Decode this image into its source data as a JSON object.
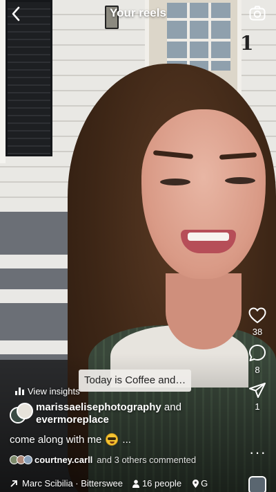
{
  "header": {
    "title": "Your reels"
  },
  "actions": {
    "likes": "38",
    "comments": "8",
    "shares": "1"
  },
  "sticker": {
    "text": "Today is Coffee and…"
  },
  "insights": {
    "label": "View insights"
  },
  "post": {
    "author": "marissaelisephotography",
    "conjunction": "and",
    "collaborator": "evermoreplace",
    "caption": "come along with me",
    "caption_suffix": "..."
  },
  "comments_summary": {
    "user": "courtney.carll",
    "rest": "and 3 others commented"
  },
  "bottom": {
    "audio": "Marc Scibilia · Bitterswee",
    "people": "16 people",
    "location": "G"
  },
  "colors": {
    "text": "#ffffff",
    "sticker_bg": "#f0eeea",
    "sticker_text": "#222222"
  },
  "icons": [
    "back-chevron-icon",
    "camera-icon",
    "heart-icon",
    "comment-icon",
    "send-icon",
    "more-icon",
    "bar-chart-icon",
    "arrow-icon",
    "person-icon",
    "location-pin-icon"
  ]
}
